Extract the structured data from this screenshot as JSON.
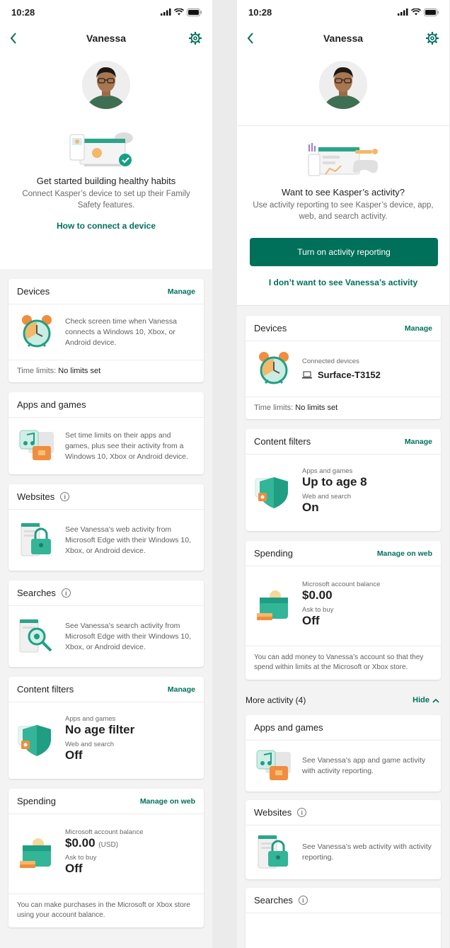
{
  "colors": {
    "accent": "#00705a",
    "page_bg": "#f3f3f3",
    "card_bg": "#ffffff"
  },
  "left": {
    "status_time": "10:28",
    "title": "Vanessa",
    "promo": {
      "title": "Get started building healthy habits",
      "subtitle": "Connect Kasper’s device to set up their Family Safety features.",
      "link": "How to connect a device"
    },
    "devices": {
      "title": "Devices",
      "action": "Manage",
      "desc": "Check screen time when Vanessa connects a Windows 10, Xbox, or Android device.",
      "time_limits_label": "Time limits:",
      "time_limits_value": "No limits set"
    },
    "apps": {
      "title": "Apps and games",
      "desc": "Set time limits on their apps and games, plus see their activity from a Windows 10, Xbox or Android device."
    },
    "websites": {
      "title": "Websites",
      "info": "i",
      "desc": "See Vanessa’s web activity from Microsoft Edge with their Windows 10, Xbox, or Android device."
    },
    "searches": {
      "title": "Searches",
      "info": "i",
      "desc": "See Vanessa’s search activity from Microsoft Edge with their Windows 10, Xbox, or Android device."
    },
    "filters": {
      "title": "Content filters",
      "action": "Manage",
      "apps_label": "Apps and games",
      "apps_value": "No age filter",
      "web_label": "Web and search",
      "web_value": "Off"
    },
    "spending": {
      "title": "Spending",
      "action": "Manage on web",
      "balance_label": "Microsoft account balance",
      "balance_value": "$0.00",
      "balance_unit": "(USD)",
      "ask_label": "Ask to buy",
      "ask_value": "Off",
      "note": "You can make purchases in the Microsoft or Xbox store using your account balance."
    }
  },
  "right": {
    "status_time": "10:28",
    "title": "Vanessa",
    "promo": {
      "title": "Want to see Kasper’s activity?",
      "subtitle": "Use activity reporting to see Kasper’s device, app, web, and search activity.",
      "button": "Turn on activity reporting",
      "link": "I don’t want to see Vanessa’s activity"
    },
    "devices": {
      "title": "Devices",
      "action": "Manage",
      "connected_label": "Connected devices",
      "device_name": "Surface-T3152",
      "time_limits_label": "Time limits:",
      "time_limits_value": "No limits set"
    },
    "filters": {
      "title": "Content filters",
      "action": "Manage",
      "apps_label": "Apps and games",
      "apps_value": "Up to age 8",
      "web_label": "Web and search",
      "web_value": "On"
    },
    "spending": {
      "title": "Spending",
      "action": "Manage on web",
      "balance_label": "Microsoft account balance",
      "balance_value": "$0.00",
      "ask_label": "Ask to buy",
      "ask_value": "Off",
      "note": "You can add money to Vanessa’s account so that they spend within limits at the Microsoft or Xbox store."
    },
    "more_activity": {
      "label": "More activity (4)",
      "hide": "Hide"
    },
    "apps": {
      "title": "Apps and games",
      "desc": "See Vanessa’s app and game activity with activity reporting."
    },
    "websites": {
      "title": "Websites",
      "info": "i",
      "desc": "See Vanessa’s web activity with activity reporting."
    },
    "searches": {
      "title": "Searches",
      "info": "i"
    }
  }
}
